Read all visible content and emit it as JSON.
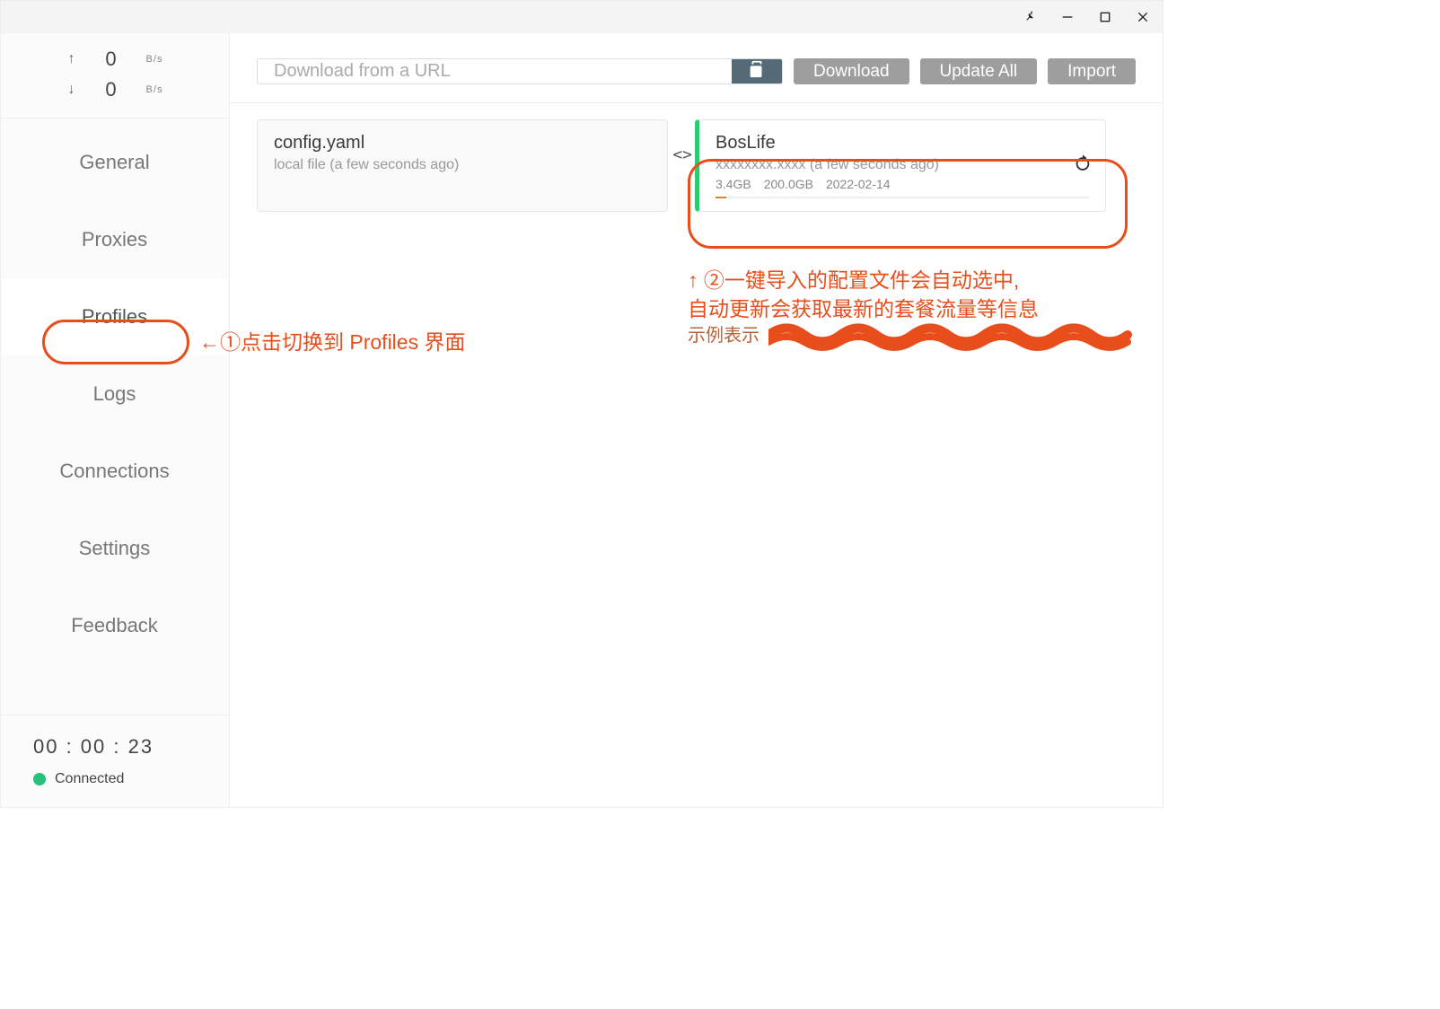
{
  "titlebar": {
    "pin_tooltip": "Pin",
    "minimize_tooltip": "Minimize",
    "maximize_tooltip": "Maximize",
    "close_tooltip": "Close"
  },
  "speed": {
    "up_value": "0",
    "up_unit": "B/s",
    "down_value": "0",
    "down_unit": "B/s"
  },
  "nav": {
    "general": "General",
    "proxies": "Proxies",
    "profiles": "Profiles",
    "logs": "Logs",
    "connections": "Connections",
    "settings": "Settings",
    "feedback": "Feedback"
  },
  "status": {
    "uptime": "00 : 00 : 23",
    "label": "Connected"
  },
  "toolbar": {
    "placeholder": "Download from a URL",
    "download": "Download",
    "update_all": "Update All",
    "import": "Import"
  },
  "cards": {
    "local": {
      "title": "config.yaml",
      "sub": "local file (a few seconds ago)"
    },
    "remote": {
      "title": "BosLife",
      "sub_time": "(a few seconds ago)",
      "used": "3.4GB",
      "total": "200.0GB",
      "expiry": "2022-02-14"
    }
  },
  "annotations": {
    "left": "←①点击切换到 Profiles 界面",
    "right_line1": "↑ ②一键导入的配置文件会自动选中,",
    "right_line2": "自动更新会获取最新的套餐流量等信息",
    "right_line3_prefix": "示例表示"
  }
}
